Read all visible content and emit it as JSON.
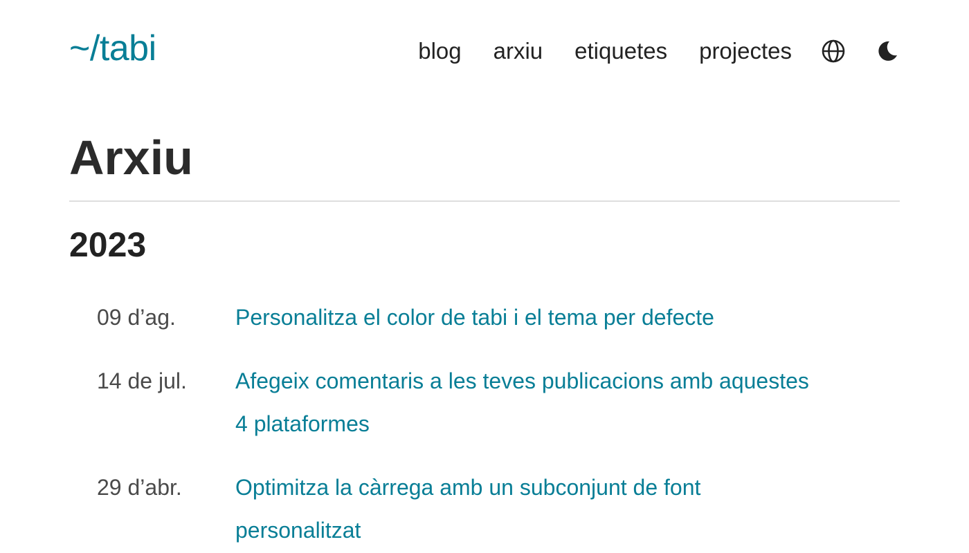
{
  "site": {
    "title": "~/tabi",
    "accent": "#087e96"
  },
  "nav": {
    "items": [
      {
        "label": "blog"
      },
      {
        "label": "arxiu"
      },
      {
        "label": "etiquetes"
      },
      {
        "label": "projectes"
      }
    ],
    "icons": [
      "globe-icon",
      "moon-icon"
    ]
  },
  "page": {
    "title": "Arxiu"
  },
  "archive": {
    "year": "2023",
    "posts": [
      {
        "date": "09 d’ag.",
        "title_lines": [
          "Personalitza el color de tabi i el tema per defecte"
        ]
      },
      {
        "date": "14 de jul.",
        "title_lines": [
          "Afegeix comentaris a les teves publicacions amb aquestes",
          "4 plataformes"
        ]
      },
      {
        "date": "29 d’abr.",
        "title_lines": [
          "Optimitza la càrrega amb un subconjunt de font",
          "personalitzat"
        ]
      }
    ]
  }
}
